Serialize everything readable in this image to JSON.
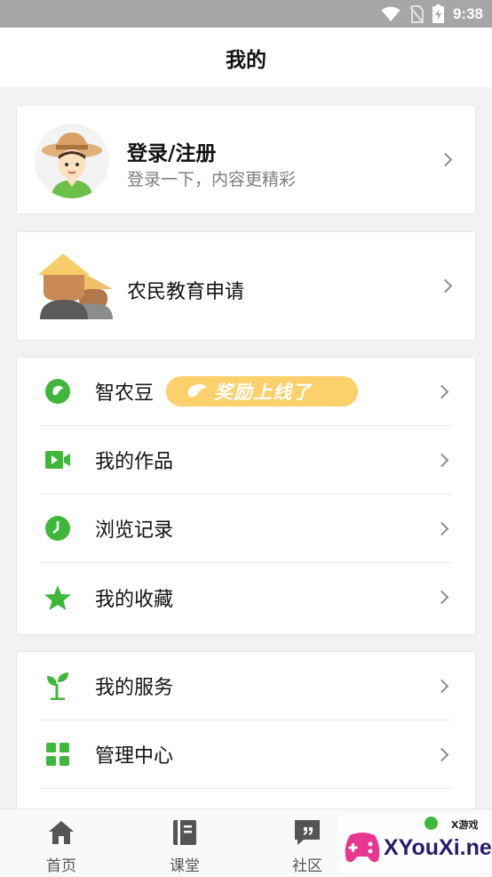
{
  "status_bar": {
    "time": "9:38"
  },
  "header": {
    "title": "我的"
  },
  "profile": {
    "title": "登录/注册",
    "subtitle": "登录一下，内容更精彩"
  },
  "farmer_education": {
    "label": "农民教育申请"
  },
  "menu_group_1": [
    {
      "label": "智农豆",
      "icon": "bean-icon",
      "badge": "奖励上线了"
    },
    {
      "label": "我的作品",
      "icon": "video-icon"
    },
    {
      "label": "浏览记录",
      "icon": "clock-icon"
    },
    {
      "label": "我的收藏",
      "icon": "star-icon"
    }
  ],
  "menu_group_2": [
    {
      "label": "我的服务",
      "icon": "sprout-icon"
    },
    {
      "label": "管理中心",
      "icon": "grid-icon"
    }
  ],
  "tabbar": [
    {
      "label": "首页",
      "icon": "home-icon"
    },
    {
      "label": "课堂",
      "icon": "book-icon"
    },
    {
      "label": "社区",
      "icon": "chat-quote-icon"
    }
  ],
  "watermark": {
    "text": "XYouXi.net",
    "small": "X游戏"
  },
  "colors": {
    "accent_green": "#3fb73b",
    "badge_yellow": "#fcd06a",
    "chevron": "#8c8c8c"
  }
}
